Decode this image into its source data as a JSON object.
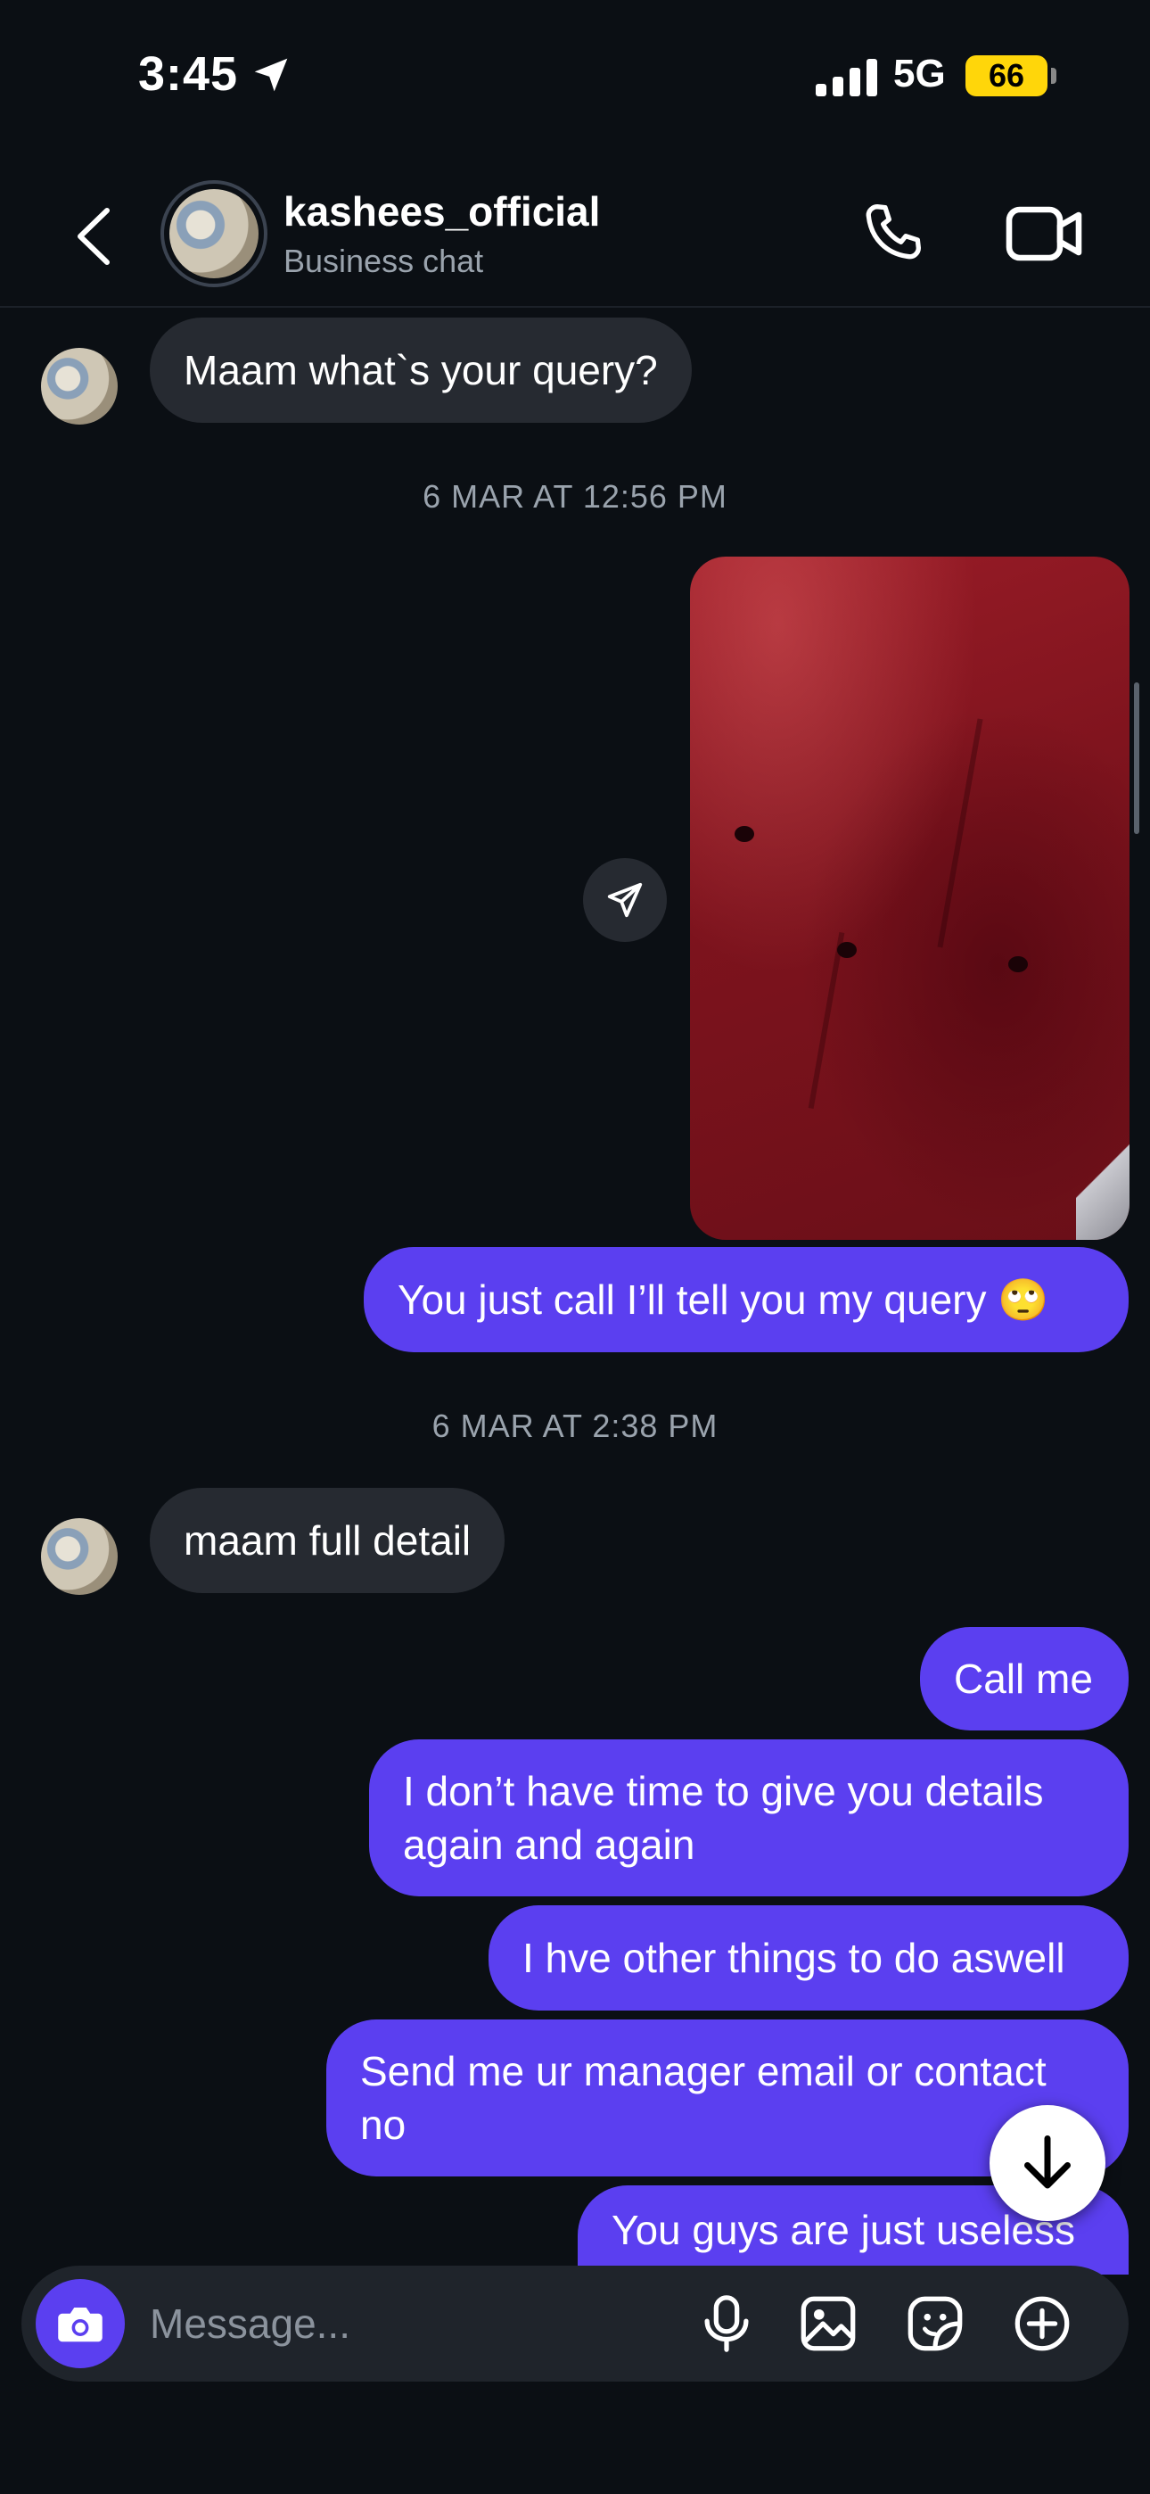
{
  "status_bar": {
    "time": "3:45",
    "network": "5G",
    "battery": "66"
  },
  "header": {
    "title": "kashees_official",
    "subtitle": "Business chat"
  },
  "messages": {
    "m1": "Maam what`s your query?",
    "ts1": "6 MAR AT 12:56 PM",
    "m2": "You just call I’ll tell you my query 🙄",
    "ts2": "6 MAR AT 2:38 PM",
    "m3": "maam full detail",
    "m4": "Call me",
    "m5": "I don’t have time to give you details again and again",
    "m6": "I hve other things to do aswell",
    "m7": "Send me ur manager email or contact no",
    "m8": "You guys are just useless"
  },
  "composer": {
    "placeholder": "Message..."
  },
  "colors": {
    "background": "#0b0f14",
    "outgoing_bubble": "#5b3ff0",
    "incoming_bubble": "#262a31",
    "battery": "#ffd60a"
  },
  "icons": [
    "location-arrow-icon",
    "signal-icon",
    "back-icon",
    "phone-icon",
    "video-icon",
    "share-icon",
    "arrow-down-icon",
    "camera-icon",
    "mic-icon",
    "gallery-icon",
    "sticker-icon",
    "plus-icon"
  ]
}
